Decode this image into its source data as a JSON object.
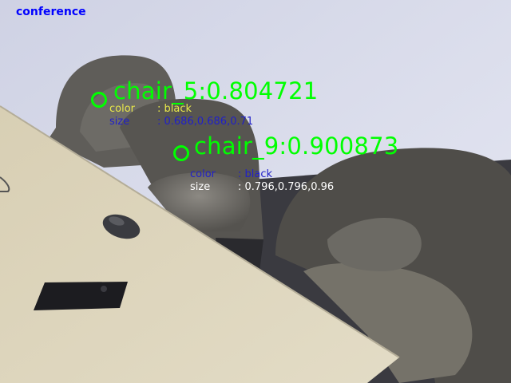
{
  "scene": {
    "label": "conference",
    "colors": {
      "scene_label": "#0000ff",
      "detection": "#00ff00",
      "yellow_text": "#e8e84a",
      "blue_text": "#2020c8",
      "white_text": "#ffffff"
    }
  },
  "detections": [
    {
      "title": "chair_5:0.804721",
      "color_key": "color",
      "color_value": ": black",
      "size_key": "size",
      "size_value": ": 0.686,0.686,0.71"
    },
    {
      "title": "chair_9:0.900873",
      "color_key": "color",
      "color_value": ": black",
      "size_key": "size",
      "size_value": ": 0.796,0.796,0.96"
    }
  ]
}
